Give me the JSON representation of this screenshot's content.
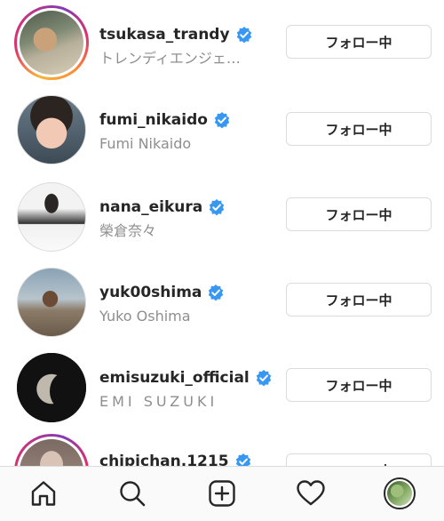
{
  "following": [
    {
      "username": "tsukasa_trandy",
      "full_name": "トレンディエンジェ…",
      "button_label": "フォロー中",
      "verified": true,
      "story_ring": true
    },
    {
      "username": "fumi_nikaido",
      "full_name": "Fumi Nikaido",
      "button_label": "フォロー中",
      "verified": true,
      "story_ring": false
    },
    {
      "username": "nana_eikura",
      "full_name": "榮倉奈々",
      "button_label": "フォロー中",
      "verified": true,
      "story_ring": false
    },
    {
      "username": "yuk00shima",
      "full_name": "Yuko Oshima",
      "button_label": "フォロー中",
      "verified": true,
      "story_ring": false
    },
    {
      "username": "emisuzuki_official",
      "full_name": "EMI SUZUKI",
      "button_label": "フォロー中",
      "verified": true,
      "story_ring": false
    },
    {
      "username": "chipichan.1215",
      "full_name": "",
      "button_label": "フォロー中",
      "verified": true,
      "story_ring": true
    }
  ],
  "tabbar": {
    "items": [
      "home-icon",
      "search-icon",
      "new-post-icon",
      "activity-heart-icon",
      "profile-avatar"
    ]
  },
  "colors": {
    "verified_badge": "#3897f0",
    "text_primary": "#262626",
    "text_secondary": "#8e8e8e",
    "button_border": "#dbdbdb"
  }
}
